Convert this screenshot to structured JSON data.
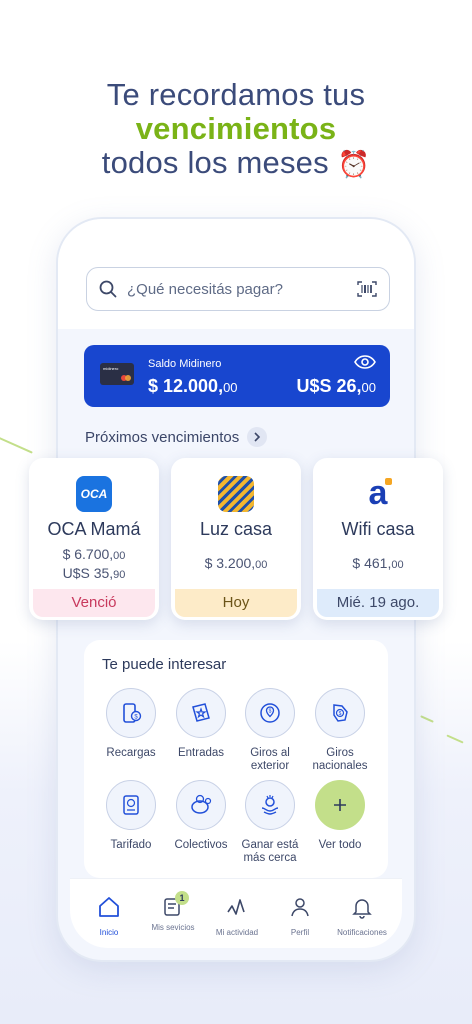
{
  "headline": {
    "line1": "Te recordamos tus",
    "accent": "vencimientos",
    "line3": "todos los meses",
    "emoji": "⏰"
  },
  "search": {
    "placeholder": "¿Qué necesitás pagar?",
    "icon": "search-icon",
    "scan_icon": "barcode-scan-icon"
  },
  "balance": {
    "title": "Saldo Midinero",
    "pesos_main": "$ 12.000,",
    "pesos_cents": "00",
    "usd_main": "U$S 26,",
    "usd_cents": "00",
    "card_brand": "midinero",
    "bg_color": "#1846cf"
  },
  "upcoming": {
    "title": "Próximos vencimientos",
    "items": [
      {
        "name": "OCA Mamá",
        "logo_text": "OCA",
        "amount1_main": "$ 6.700,",
        "amount1_cents": "00",
        "amount2_main": "U$S 35,",
        "amount2_cents": "90",
        "status": "Venció",
        "status_color": "#c8395d",
        "status_bg": "#fde7ee"
      },
      {
        "name": "Luz casa",
        "logo_text": "",
        "amount1_main": "$ 3.200,",
        "amount1_cents": "00",
        "status": "Hoy",
        "status_color": "#6b5418",
        "status_bg": "#fdebc8"
      },
      {
        "name": "Wifi casa",
        "logo_text": "a",
        "amount1_main": "$ 461,",
        "amount1_cents": "00",
        "status": "Mié. 19 ago.",
        "status_color": "#3d4868",
        "status_bg": "#deebfb"
      }
    ]
  },
  "interest": {
    "title": "Te puede interesar",
    "items": [
      {
        "label": "Recargas",
        "icon": "phone-recharge-icon"
      },
      {
        "label": "Entradas",
        "icon": "ticket-star-icon"
      },
      {
        "label": "Giros al exterior",
        "icon": "globe-transfer-icon"
      },
      {
        "label": "Giros nacionales",
        "icon": "national-transfer-icon"
      },
      {
        "label": "Tarifado",
        "icon": "tariff-icon"
      },
      {
        "label": "Colectivos",
        "icon": "piggy-bank-icon"
      },
      {
        "label": "Ganar está más cerca",
        "icon": "lottery-icon"
      },
      {
        "label": "Ver todo",
        "icon": "plus-icon"
      }
    ]
  },
  "nav": {
    "items": [
      {
        "label": "Inicio",
        "icon": "home-icon",
        "active": true
      },
      {
        "label": "Mis sevicios",
        "icon": "services-icon",
        "badge": "1"
      },
      {
        "label": "Mi actividad",
        "icon": "activity-icon"
      },
      {
        "label": "Perfil",
        "icon": "profile-icon"
      },
      {
        "label": "Notificaciones",
        "icon": "bell-icon"
      }
    ]
  },
  "colors": {
    "accent_green": "#7ab317",
    "brand_blue": "#1846cf",
    "text_dark": "#3b4b7a"
  }
}
